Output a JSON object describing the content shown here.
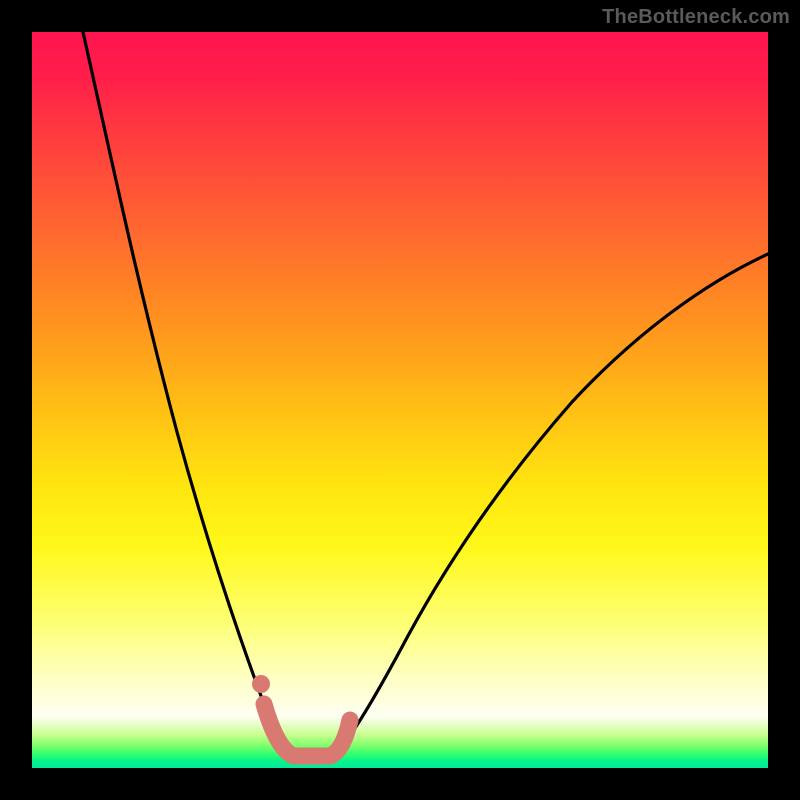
{
  "attribution": "TheBottleneck.com",
  "chart_data": {
    "type": "line",
    "title": "",
    "xlabel": "",
    "ylabel": "",
    "xlim": [
      0,
      100
    ],
    "ylim": [
      0,
      100
    ],
    "grid": false,
    "legend": false,
    "series": [
      {
        "name": "left-branch",
        "x": [
          7,
          12,
          16,
          20,
          24,
          27,
          29,
          31,
          33,
          34.5
        ],
        "y": [
          100,
          77,
          58,
          41,
          26,
          15,
          9,
          5,
          2.5,
          1.5
        ]
      },
      {
        "name": "right-branch",
        "x": [
          40.5,
          42.5,
          45,
          49,
          54,
          60,
          67,
          75,
          84,
          93,
          100
        ],
        "y": [
          1.5,
          3,
          6,
          12,
          20,
          29,
          38,
          47,
          55,
          62,
          67
        ]
      },
      {
        "name": "valley-marker",
        "x": [
          31.5,
          33.2,
          34.5,
          36.5,
          38.5,
          40.5,
          41.8,
          42.8
        ],
        "y": [
          8.5,
          3.5,
          1.8,
          1.3,
          1.3,
          1.8,
          3.5,
          6.5
        ]
      }
    ],
    "annotations": [
      {
        "name": "valley-dot",
        "x": 31.2,
        "y": 11.5
      }
    ],
    "colors": {
      "curve": "#000000",
      "marker": "#d97a72",
      "gradient_top": "#ff1450",
      "gradient_bottom": "#04e99b"
    }
  }
}
